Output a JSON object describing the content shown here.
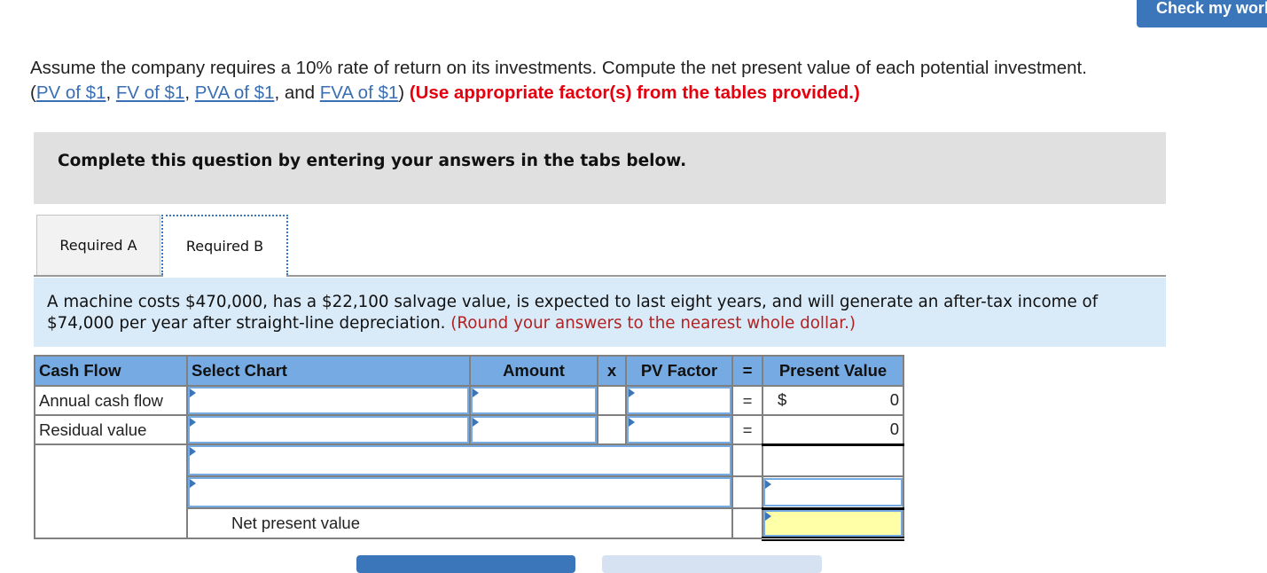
{
  "header": {
    "check_button": "Check my work"
  },
  "prompt": {
    "text_before": "Assume the company requires a 10% rate of return on its investments. Compute the net present value of each potential investment.",
    "open_paren": "(",
    "links": [
      "PV of $1",
      "FV of $1",
      "PVA of $1",
      "FVA of $1"
    ],
    "sep1": ", ",
    "sep2": ", ",
    "sep3": ", and ",
    "close_paren": ")",
    "instruction": "(Use appropriate factor(s) from the tables provided.)"
  },
  "banner": {
    "text": "Complete this question by entering your answers in the tabs below."
  },
  "tabs": [
    {
      "label": "Required A",
      "active": false
    },
    {
      "label": "Required B",
      "active": true
    }
  ],
  "description": {
    "text": "A machine costs $470,000, has a $22,100 salvage value, is expected to last eight years, and will generate an after-tax income of $74,000 per year after straight-line depreciation.",
    "note": "(Round your answers to the nearest whole dollar.)"
  },
  "worksheet": {
    "headers": [
      "Cash Flow",
      "Select Chart",
      "Amount",
      "x",
      "PV Factor",
      "=",
      "Present Value"
    ],
    "rows": [
      {
        "cash_flow": "Annual cash flow",
        "select_chart": "",
        "amount": "",
        "pv_factor": "",
        "eq": "=",
        "currency": "$",
        "present_value": "0"
      },
      {
        "cash_flow": "Residual value",
        "select_chart": "",
        "amount": "",
        "pv_factor": "",
        "eq": "=",
        "currency": "",
        "present_value": "0"
      }
    ],
    "extra_rows": [
      "",
      ""
    ],
    "npv_label": "Net present value",
    "npv_value": ""
  },
  "colors": {
    "accent": "#3a76b9",
    "header_bg": "#75aae3",
    "highlight": "#ffffa8",
    "instruction_red": "#e4000f",
    "note_red": "#b22222"
  }
}
